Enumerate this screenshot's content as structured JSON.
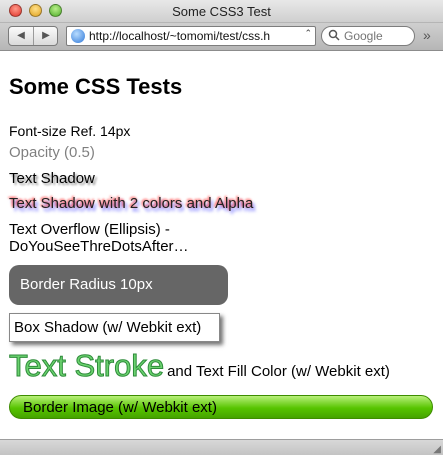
{
  "window": {
    "title": "Some CSS3 Test"
  },
  "toolbar": {
    "back_icon": "◀",
    "forward_icon": "▶",
    "url": "http://localhost/~tomomi/test/css.h",
    "addr_arrows": "⌃",
    "search_placeholder": "Google",
    "overflow": "»"
  },
  "content": {
    "heading": "Some CSS Tests",
    "font_size_ref": "Font-size Ref. 14px",
    "opacity": "Opacity (0.5)",
    "text_shadow": "Text Shadow",
    "text_shadow_2": "Text Shadow with 2 colors and Alpha",
    "text_overflow_line1": "Text Overflow (Ellipsis) -",
    "text_overflow_line2": "DoYouSeeThreDotsAfter…",
    "border_radius": "Border Radius 10px",
    "box_shadow": "Box Shadow (w/ Webkit ext)",
    "text_stroke": "Text Stroke",
    "text_fill": "and Text Fill Color (w/ Webkit ext)",
    "border_image": "Border Image (w/ Webkit ext)"
  },
  "colors": {
    "radius_box": "#666666",
    "stroke": "#2e8b3a",
    "border_image_green": "#57c400"
  }
}
